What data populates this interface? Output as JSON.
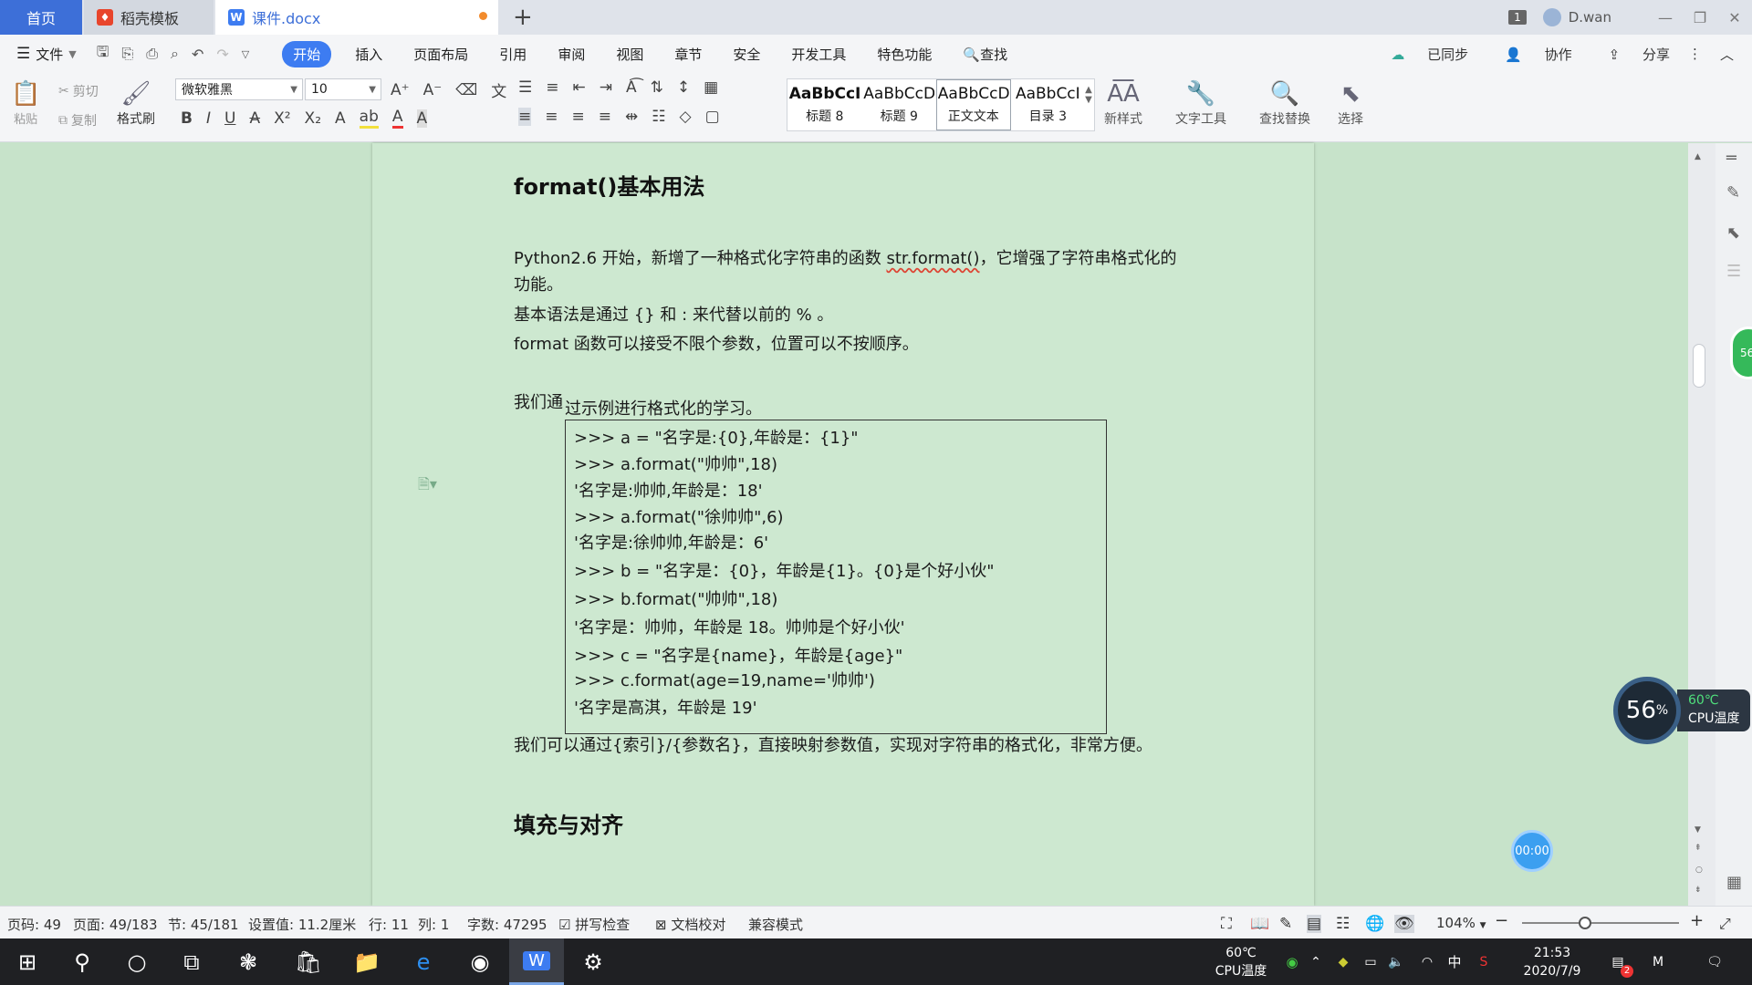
{
  "tabs": {
    "home": "首页",
    "templates": "稻壳模板",
    "document": "课件.docx",
    "add": "+"
  },
  "titlebar": {
    "badge": "1",
    "user": "D.wan",
    "min": "—",
    "restore": "❐",
    "close": "✕"
  },
  "menu": {
    "file": "文件",
    "items": [
      "开始",
      "插入",
      "页面布局",
      "引用",
      "审阅",
      "视图",
      "章节",
      "安全",
      "开发工具",
      "特色功能"
    ],
    "search": "查找",
    "sync": "已同步",
    "collab": "协作",
    "share": "分享"
  },
  "ribbon": {
    "paste": "粘贴",
    "cut": "剪切",
    "copy": "复制",
    "format_painter": "格式刷",
    "font_name": "微软雅黑",
    "font_size": "10",
    "styles": [
      {
        "sample": "AaBbCcI",
        "name": "标题 8",
        "bold": true
      },
      {
        "sample": "AaBbCcD",
        "name": "标题 9",
        "bold": false
      },
      {
        "sample": "AaBbCcD",
        "name": "正文文本",
        "bold": false
      },
      {
        "sample": "AaBbCcI",
        "name": "目录 3",
        "bold": false
      }
    ],
    "new_style": "新样式",
    "text_tools": "文字工具",
    "find_replace": "查找替换",
    "select": "选择"
  },
  "document": {
    "heading1": "format()基本用法",
    "p1_a": "Python2.6 开始，新增了一种格式化字符串的函数 ",
    "p1_b": "str.format()",
    "p1_c": "，它增强了字符串格式化的",
    "p1_line2": "功能。",
    "p2": "基本语法是通过 {} 和 : 来代替以前的 % 。",
    "p3": "format 函数可以接受不限个参数，位置可以不按顺序。",
    "p4_a": "我们通",
    "p4_b": "过示例进行格式化的学习。",
    "code": [
      ">>> a = \"名字是:{0},年龄是：{1}\"",
      ">>> a.format(\"帅帅\",18)",
      "'名字是:帅帅,年龄是：18'",
      ">>> a.format(\"徐帅帅\",6)",
      "'名字是:徐帅帅,年龄是：6'",
      ">>> b = \"名字是：{0}，年龄是{1}。{0}是个好小伙\"",
      ">>> b.format(\"帅帅\",18)",
      "'名字是：帅帅，年龄是 18。帅帅是个好小伙'",
      ">>> c = \"名字是{name}，年龄是{age}\"",
      ">>> c.format(age=19,name='帅帅')",
      "'名字是高淇，年龄是 19'"
    ],
    "p5": "我们可以通过{索引}/{参数名}，直接映射参数值，实现对字符串的格式化，非常方便。",
    "heading2": "填充与对齐"
  },
  "widgets": {
    "side_badge": "56",
    "cpu_percent": "56",
    "cpu_percent_sign": "%",
    "cpu_temp": "60℃",
    "cpu_label": "CPU温度",
    "timer": "00:00"
  },
  "status": {
    "page_code": "页码: 49",
    "pages": "页面: 49/183",
    "section": "节: 45/181",
    "setting": "设置值: 11.2厘米",
    "row": "行: 11",
    "col": "列: 1",
    "words": "字数: 47295",
    "spell": "拼写检查",
    "proof": "文档校对",
    "compat": "兼容模式",
    "zoom": "104%",
    "zoom_level": 0.4
  },
  "taskbar": {
    "cpu_temp": "60℃",
    "cpu_label": "CPU温度",
    "ime": "中",
    "time": "21:53",
    "date": "2020/7/9",
    "notif_badge": "2"
  },
  "colors": {
    "accent": "#3d7cf1",
    "doc_bg": "#c7e3ca",
    "page_bg": "#cde8d0"
  }
}
